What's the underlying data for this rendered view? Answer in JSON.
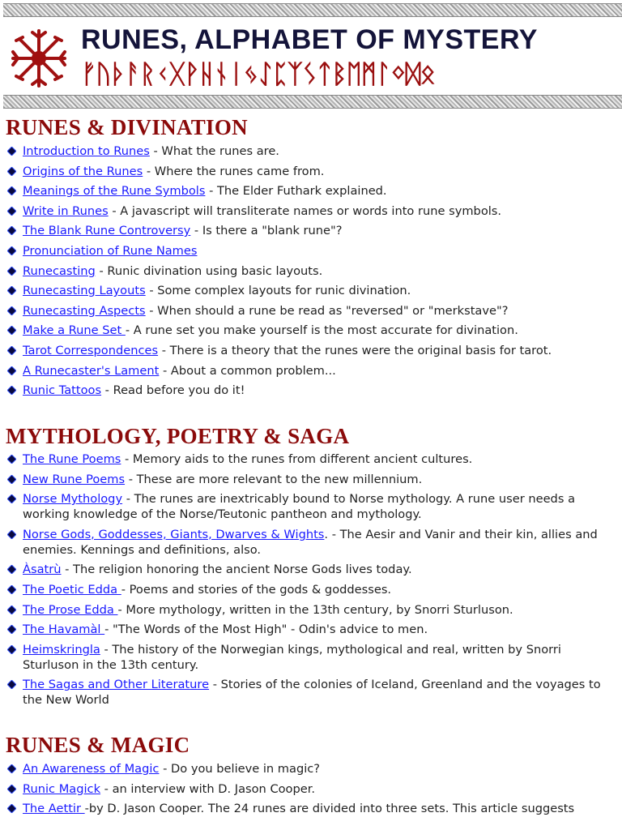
{
  "banner": {
    "title": "RUNES, ALPHABET OF MYSTERY",
    "runes": "ᚠᚢᚦᚨᚱᚲᚷᚹᚺᚾᛁᛃᛇᛈᛉᛊᛏᛒᛖᛗᛚᛜᛞᛟ"
  },
  "colors": {
    "heading": "#8b0a0a",
    "link": "#1a1aff",
    "title": "#14143a"
  },
  "sections": [
    {
      "title": "RUNES & DIVINATION",
      "items": [
        {
          "link": "Introduction to Runes",
          "text": " - What the runes are."
        },
        {
          "link": "Origins of the Runes",
          "text": " - Where the runes came from."
        },
        {
          "link": "Meanings of the Rune Symbols",
          "text": " - The Elder Futhark explained."
        },
        {
          "link": "Write in Runes",
          "text": " - A javascript will transliterate names or words into rune symbols."
        },
        {
          "link": "The Blank Rune Controversy",
          "text": " - Is there a \"blank rune\"?"
        },
        {
          "link": "Pronunciation of Rune Names",
          "text": ""
        },
        {
          "link": "Runecasting",
          "text": " - Runic divination using basic layouts."
        },
        {
          "link": "Runecasting Layouts",
          "text": " - Some complex layouts for runic divination."
        },
        {
          "link": "Runecasting Aspects",
          "text": " - When should a rune be read as \"reversed\" or \"merkstave\"?"
        },
        {
          "link": "Make a Rune Set ",
          "text": "- A rune set you make yourself is the most accurate for divination."
        },
        {
          "link": "Tarot Correspondences",
          "text": " - There is a theory that the runes were the original basis for tarot."
        },
        {
          "link": "A Runecaster's Lament",
          "text": " - About a common problem..."
        },
        {
          "link": "Runic Tattoos",
          "text": " - Read before you do it!"
        }
      ]
    },
    {
      "title": "MYTHOLOGY, POETRY & SAGA",
      "items": [
        {
          "link": "The Rune Poems",
          "text": " - Memory aids to the runes from different ancient cultures."
        },
        {
          "link": "New Rune Poems",
          "text": " - These are more relevant to the new millennium."
        },
        {
          "link": "Norse Mythology",
          "text": " - The runes are inextricably bound to Norse mythology. A rune user needs a working knowledge of the Norse/Teutonic pantheon and mythology."
        },
        {
          "link": "Norse Gods, Goddesses, Giants, Dwarves & Wights",
          "text": ". - The Aesir and Vanir and their kin, allies and enemies. Kennings and definitions, also."
        },
        {
          "link": "Àsatrù",
          "text": " - The religion honoring the ancient Norse Gods lives today."
        },
        {
          "link": "The Poetic Edda ",
          "text": " - Poems and stories of the gods & goddesses."
        },
        {
          "link": "The Prose Edda ",
          "text": "- More mythology, written in the 13th century, by Snorri Sturluson."
        },
        {
          "link": "The Havamàl ",
          "text": "- \"The Words of the Most High\" - Odin's advice to men."
        },
        {
          "link": "Heimskringla",
          "text": " - The history of the Norwegian kings, mythological and real, written by Snorri Sturluson in the 13th century."
        },
        {
          "link": "The Sagas and Other Literature",
          "text": " - Stories of the colonies of Iceland, Greenland and the voyages to the New World"
        }
      ]
    },
    {
      "title": "RUNES & MAGIC",
      "items": [
        {
          "link": "An Awareness of Magic",
          "text": " - Do you believe in magic?"
        },
        {
          "link": "Runic Magick",
          "text": " - an interview with D. Jason Cooper."
        },
        {
          "link": "The Aettir ",
          "text": "-by D. Jason Cooper. The 24 runes are divided into three sets. This article suggests"
        }
      ]
    }
  ]
}
